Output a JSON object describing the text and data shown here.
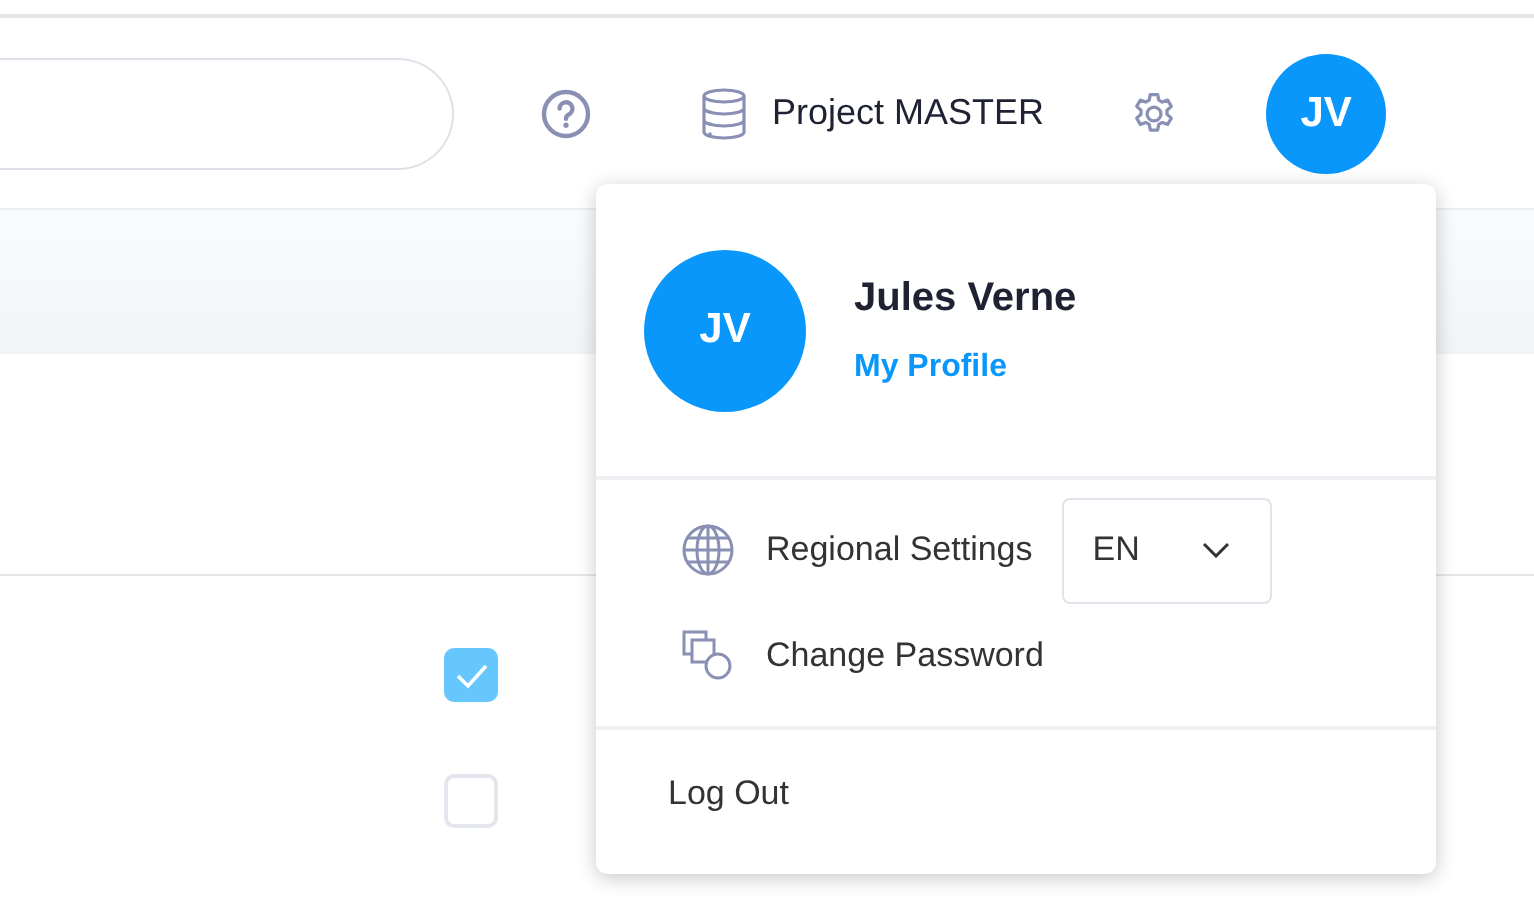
{
  "header": {
    "project": "Project MASTER",
    "avatar_initials": "JV"
  },
  "table_rows": [
    {
      "checked": true
    },
    {
      "checked": false
    }
  ],
  "profile_menu": {
    "avatar_initials": "JV",
    "name": "Jules Verne",
    "link": "My Profile",
    "items": [
      {
        "kind": "regional",
        "label": "Regional Settings",
        "language": "EN"
      },
      {
        "kind": "password",
        "label": "Change Password"
      }
    ],
    "logout": "Log Out"
  }
}
